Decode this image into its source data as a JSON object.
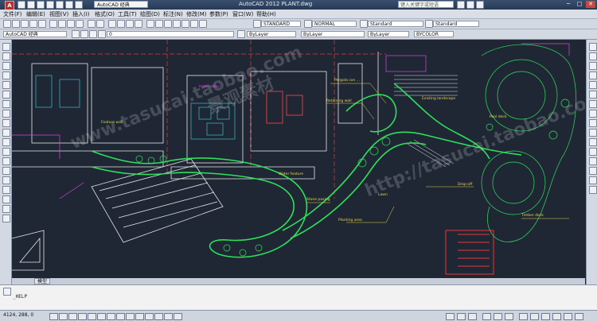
{
  "app": {
    "title": "AutoCAD 2012    PLANT.dwg",
    "logo": "A",
    "workspace": "AutoCAD 经典",
    "search_placeholder": "键入关键字或短语",
    "window_controls": [
      "─",
      "□",
      "✕"
    ]
  },
  "menu": [
    "文件(F)",
    "编辑(E)",
    "视图(V)",
    "插入(I)",
    "格式(O)",
    "工具(T)",
    "绘图(D)",
    "标注(N)",
    "修改(M)",
    "参数(P)",
    "窗口(W)",
    "帮助(H)"
  ],
  "toolbar": {
    "workspace_combo": "AutoCAD 经典",
    "layer_value": "0",
    "text_style": "STANDARD",
    "dim_style": "NORMAL",
    "table_style": "Standard",
    "multileader_style": "Standard",
    "color": "ByLayer",
    "linetype": "ByLayer",
    "lineweight": "ByLayer",
    "plotstyle": "BYCOLOR"
  },
  "layout_tabs": [
    "模型"
  ],
  "command": {
    "history": "",
    "lines": [
      "_HELP"
    ],
    "prompt": ""
  },
  "status": {
    "coords": "4124, 288, 0"
  },
  "drawing": {
    "labels": [
      "Pergola con ...",
      "Retaining wall",
      "Feature wall",
      "Existing landscape",
      "Drop-off",
      "Water feature",
      "Hotel lobby",
      "Planting area",
      "Stone paving",
      "Timber deck",
      "Lawn",
      "Pool deck"
    ],
    "watermarks": [
      "www.tasucai.taobao.com",
      "http://tasucai.taobao.com",
      "景观素材"
    ]
  },
  "colors": {
    "background": "#1f2735",
    "green": "#2ee05a",
    "white": "#e8e8e8",
    "red": "#e03a3a",
    "magenta": "#e040e0",
    "yellow": "#e6d84a",
    "cyan": "#40d8e0"
  }
}
